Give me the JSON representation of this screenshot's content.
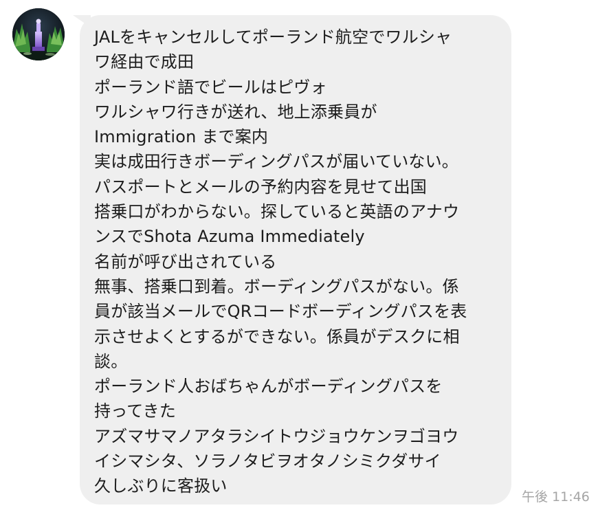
{
  "chat": {
    "sender": {
      "avatar_icon": "monument-at-night-photo"
    },
    "message": {
      "lines": [
        "JALをキャンセルしてポーランド航空でワルシャ",
        "ワ経由で成田",
        "ポーランド語でビールはピヴォ",
        "ワルシャワ行きが送れ、地上添乗員が",
        "Immigration まで案内",
        "実は成田行きボーディングパスが届いていない。",
        "パスポートとメールの予約内容を見せて出国",
        "搭乗口がわからない。探していると英語のアナウ",
        "ンスでShota Azuma Immediately",
        "名前が呼び出されている",
        "無事、搭乗口到着。ボーディングパスがない。係",
        "員が該当メールでQRコードボーディングパスを表",
        "示させよくとするができない。係員がデスクに相",
        "談。",
        "ポーランド人おばちゃんがボーディングパスを",
        "持ってきた",
        "アズマサマノアタラシイトウジョウケンヲゴヨウ",
        "イシマシタ、ソラノタビヲオタノシミクダサイ",
        "久しぶりに客扱い"
      ],
      "timestamp": "午後 11:46"
    },
    "colors": {
      "bubble_background": "#efefef",
      "message_text": "#1c1c1c",
      "timestamp_text": "#a5a5a5",
      "page_background": "#ffffff"
    }
  }
}
